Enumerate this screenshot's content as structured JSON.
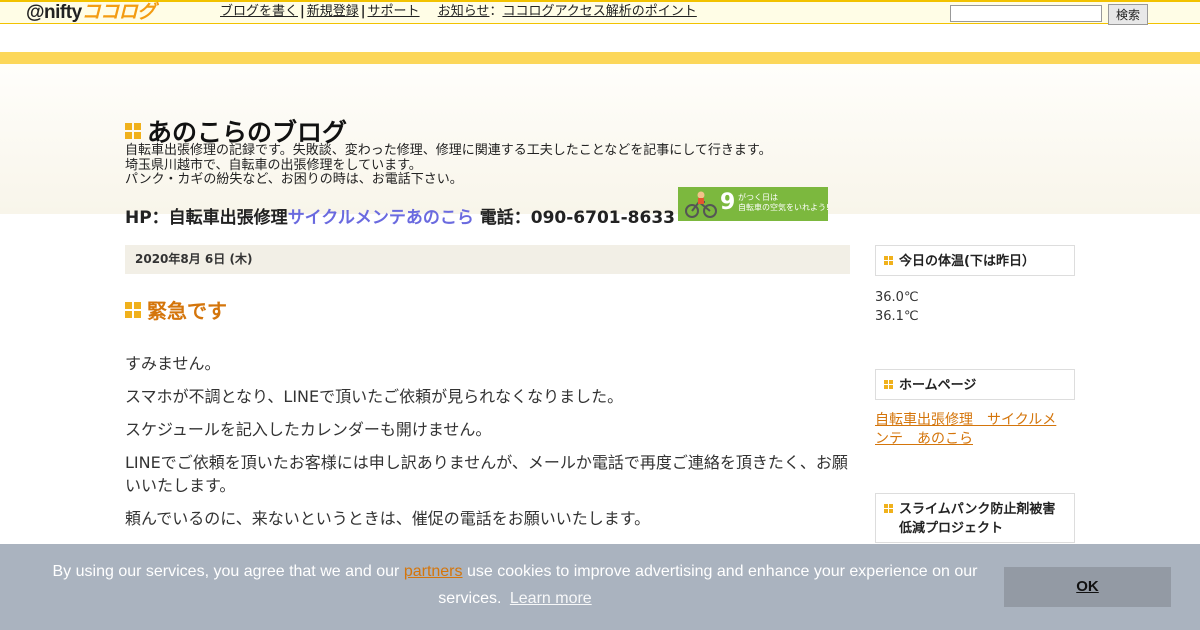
{
  "topbar": {
    "logo_prefix": "@nifty",
    "logo_brand": "ココログ",
    "nav": [
      {
        "label": "ブログを書く"
      },
      {
        "label": "新規登録"
      },
      {
        "label": "サポート"
      }
    ],
    "info_label": "お知らせ",
    "info_link": "ココログアクセス解析のポイント",
    "search_value": "",
    "search_button": "検索"
  },
  "header": {
    "title": "あのこらのブログ",
    "description": [
      "自転車出張修理の記録です。失敗談、変わった修理、修理に関連する工夫したことなどを記事にして行きます。",
      "埼玉県川越市で、自転車の出張修理をしています。",
      "パンク・カギの紛失など、お困りの時は、お電話下さい。"
    ],
    "hp_prefix": "HP：自転車出張修理",
    "hp_link": "サイクルメンテあのこら",
    "phone": "電話：090-6701-8633",
    "banner_number": "9",
    "banner_text_1": "がつく日は",
    "banner_text_2": "自転車の空気をいれよう!"
  },
  "post": {
    "date": "2020年8月 6日 (木)",
    "title": "緊急です",
    "paragraphs": [
      "すみません。",
      "スマホが不調となり、LINEで頂いたご依頼が見られなくなりました。",
      "スケジュールを記入したカレンダーも開けません。",
      "LINEでご依頼を頂いたお客様には申し訳ありませんが、メールか電話で再度ご連絡を頂きたく、お願いいたします。",
      "頼んでいるのに、来ないというときは、催促の電話をお願いいたします。"
    ]
  },
  "sidebar": {
    "temp_title": "今日の体温(下は昨日）",
    "temp_today": "36.0℃",
    "temp_yesterday": "36.1℃",
    "home_title": "ホームページ",
    "home_link": "自転車出張修理　サイクルメンテ　あのこら",
    "slime_title": "スライムパンク防止剤被害低減プロジェクト"
  },
  "cookie": {
    "text_before": "By using our services, you agree that we and our ",
    "partners": "partners",
    "text_after": " use cookies to improve advertising and enhance your experience on our services.",
    "learn_more": "Learn more",
    "ok": "OK"
  },
  "colors": {
    "accent_orange": "#d4750b",
    "stripe_yellow": "#fcd75a",
    "square_yellow": "#f0b11c",
    "link_blue": "#6a6adf",
    "banner_green": "#7cb83e",
    "cookie_bg": "#aab3bf"
  }
}
